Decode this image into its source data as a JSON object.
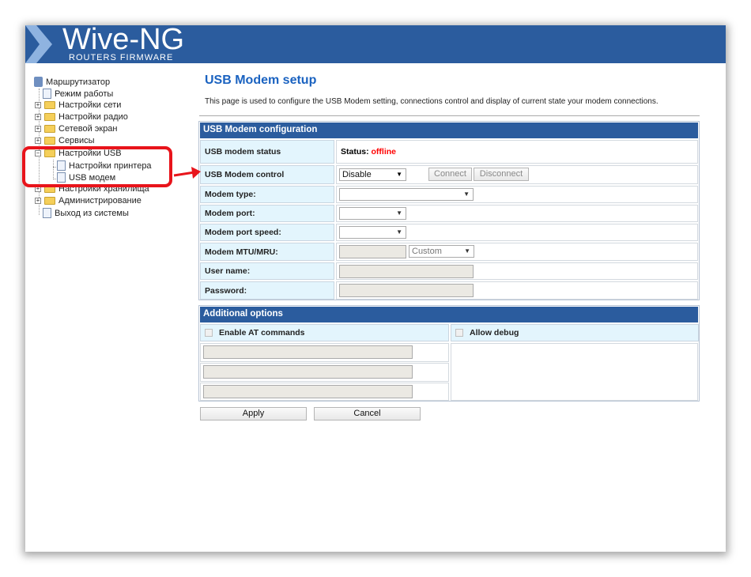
{
  "brand": {
    "title": "Wive-NG",
    "subtitle": "ROUTERS FIRMWARE",
    "color": "#2b5c9e"
  },
  "sidebar": {
    "root": "Маршрутизатор",
    "items": [
      {
        "label": "Режим работы",
        "type": "doc"
      },
      {
        "label": "Настройки сети",
        "type": "folder"
      },
      {
        "label": "Настройки радио",
        "type": "folder"
      },
      {
        "label": "Сетевой экран",
        "type": "folder"
      },
      {
        "label": "Сервисы",
        "type": "folder"
      },
      {
        "label": "Настройки USB",
        "type": "folder-open"
      },
      {
        "label": "Настройки принтера",
        "type": "doc"
      },
      {
        "label": "USB модем",
        "type": "doc"
      },
      {
        "label": "Настройки хранилища",
        "type": "folder"
      },
      {
        "label": "Администрирование",
        "type": "folder"
      },
      {
        "label": "Выход из системы",
        "type": "doc"
      }
    ]
  },
  "main": {
    "title": "USB Modem setup",
    "description": "This page is used to configure the USB Modem setting, connections control and display of current state your modem connections.",
    "config": {
      "header": "USB Modem configuration",
      "status_label": "USB modem status",
      "status_prefix": "Status:",
      "status_value": "offline",
      "status_color": "#ff0000",
      "control_label": "USB Modem control",
      "control_value": "Disable",
      "connect": "Connect",
      "disconnect": "Disconnect",
      "type_label": "Modem type:",
      "type_value": "",
      "port_label": "Modem port:",
      "port_value": "",
      "speed_label": "Modem port speed:",
      "speed_value": "",
      "mtu_label": "Modem MTU/MRU:",
      "mtu_value": "",
      "mtu_mode": "Custom",
      "user_label": "User name:",
      "user_value": "",
      "password_label": "Password:",
      "password_value": ""
    },
    "additional": {
      "header": "Additional options",
      "at_label": "Enable AT commands",
      "at_checked": false,
      "debug_label": "Allow debug",
      "debug_checked": false,
      "at_commands": [
        "",
        "",
        ""
      ]
    },
    "apply": "Apply",
    "cancel": "Cancel"
  },
  "annotation_color": "#e8141b"
}
